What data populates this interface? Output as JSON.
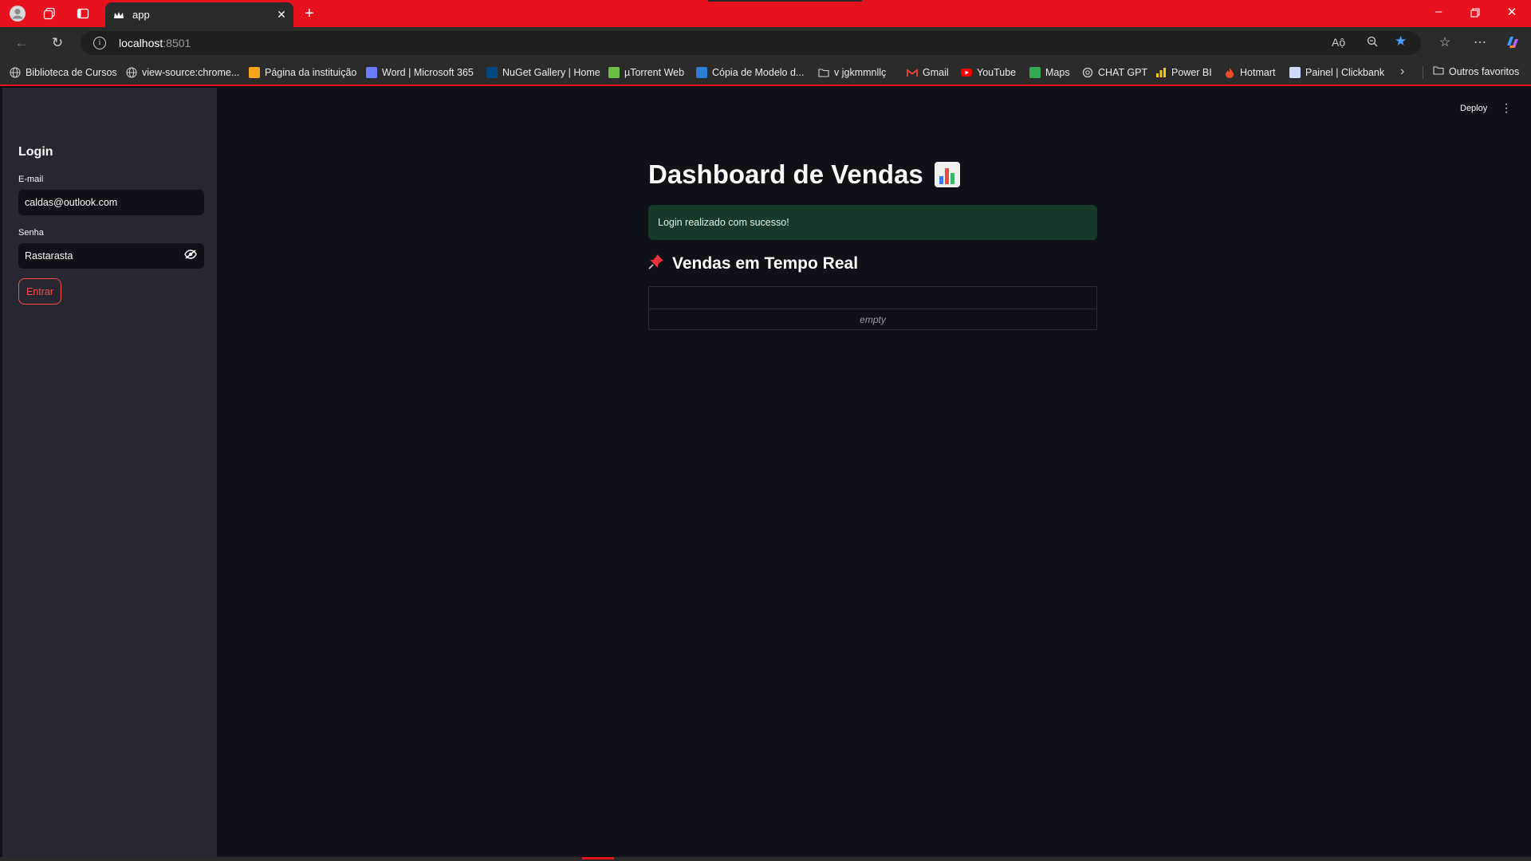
{
  "browser": {
    "tab_title": "app",
    "url_host": "localhost",
    "url_port": ":8501",
    "new_tab_symbol": "+",
    "close_symbol": "✕"
  },
  "bookmarks": [
    {
      "label": "Biblioteca de Cursos",
      "icon": "globe-icon",
      "color": "#cfcfcf"
    },
    {
      "label": "view-source:chrome...",
      "icon": "globe-icon",
      "color": "#cfcfcf"
    },
    {
      "label": "Página da instituição",
      "icon": "page-icon",
      "color": "#f2a71b"
    },
    {
      "label": "Word | Microsoft 365",
      "icon": "word365-icon",
      "color": "#6b7cff"
    },
    {
      "label": "NuGet Gallery | Home",
      "icon": "nuget-icon",
      "color": "#004880"
    },
    {
      "label": "µTorrent Web",
      "icon": "utorrent-icon",
      "color": "#6dbe45"
    },
    {
      "label": "Cópia de Modelo d...",
      "icon": "word-icon",
      "color": "#2b7cd3"
    },
    {
      "label": "v jgkmmnllç",
      "icon": "folder-icon",
      "color": "#cfcfcf"
    },
    {
      "label": "Gmail",
      "icon": "gmail-icon",
      "color": "#ea4335"
    },
    {
      "label": "YouTube",
      "icon": "youtube-icon",
      "color": "#ff0000"
    },
    {
      "label": "Maps",
      "icon": "maps-icon",
      "color": "#34a853"
    },
    {
      "label": "CHAT GPT",
      "icon": "chatgpt-icon",
      "color": "#cfcfcf"
    },
    {
      "label": "Power BI",
      "icon": "powerbi-icon",
      "color": "#f2c811"
    },
    {
      "label": "Hotmart",
      "icon": "hotmart-icon",
      "color": "#ef4e23"
    },
    {
      "label": "Painel | Clickbank",
      "icon": "clickbank-icon",
      "color": "#cfd8ff"
    }
  ],
  "other_bookmarks": "Outros favoritos",
  "app": {
    "deploy_label": "Deploy",
    "sidebar": {
      "title": "Login",
      "email_label": "E-mail",
      "email_value": "caldas@outlook.com",
      "password_label": "Senha",
      "password_value": "Rastarasta",
      "submit_label": "Entrar"
    },
    "main": {
      "title": "Dashboard de Vendas",
      "success_message": "Login realizado com sucesso!",
      "section_title": "Vendas em Tempo Real",
      "dataframe_empty": "empty"
    }
  },
  "colors": {
    "browser_accent": "#e8111e",
    "app_bg": "#0e1117",
    "sidebar_bg": "#262730",
    "primary": "#ff4b4b",
    "success_bg": "#173928"
  }
}
